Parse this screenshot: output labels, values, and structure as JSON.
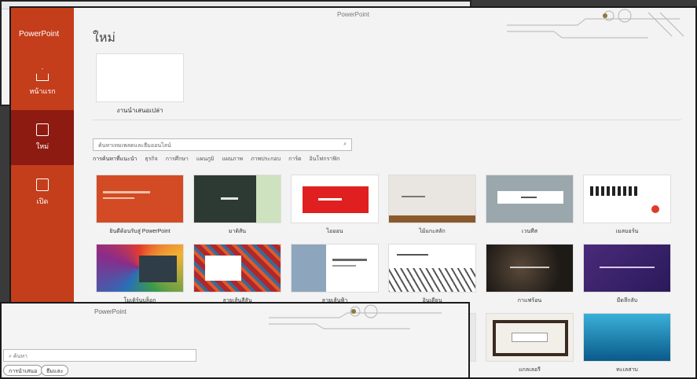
{
  "window": {
    "title": "PowerPoint"
  },
  "sidebar": {
    "app_name": "PowerPoint",
    "items": [
      {
        "label": "หน้าแรก",
        "icon": "home-icon"
      },
      {
        "label": "ใหม่",
        "icon": "new-file-icon",
        "active": true
      },
      {
        "label": "เปิด",
        "icon": "open-folder-icon"
      }
    ]
  },
  "main": {
    "page_title": "ใหม่",
    "blank_label": "งานนำเสนอเปล่า",
    "search_placeholder": "ค้นหาเทมเพลตและธีมออนไลน์",
    "suggested": [
      "การค้นหาที่แนะนำ",
      "ธุรกิจ",
      "การศึกษา",
      "แผนภูมิ",
      "แผนภาพ",
      "ภาพประกอบ",
      "การ์ด",
      "อินโฟกราฟิก"
    ],
    "templates": [
      {
        "label": "ยินดีต้อนรับสู่ PowerPoint"
      },
      {
        "label": "มาดิสัน"
      },
      {
        "label": "ไอออน"
      },
      {
        "label": "ไม้แกะสลัก"
      },
      {
        "label": "เวนทีส"
      },
      {
        "label": "เมลบอร์น"
      },
      {
        "label": "โมเดิร์นบล็อก"
      },
      {
        "label": "ลายเส้นสีสัน"
      },
      {
        "label": "ลายเส้นฟ้า"
      },
      {
        "label": "อินเดียน"
      },
      {
        "label": "กาแฟร้อน"
      },
      {
        "label": "มืดลึกลับ"
      },
      {
        "label": ""
      },
      {
        "label": ""
      },
      {
        "label": ""
      },
      {
        "label": ""
      },
      {
        "label": "แกลเลอรี"
      },
      {
        "label": "ทะเลสาบ"
      }
    ]
  },
  "overlay": {
    "title": "PowerPoint",
    "search_placeholder": "ค้นหา",
    "chips": [
      "การนำเสนอ",
      "ธีมและ"
    ]
  },
  "colors": {
    "accent": "#c43e1c",
    "active": "#8e1b12"
  }
}
